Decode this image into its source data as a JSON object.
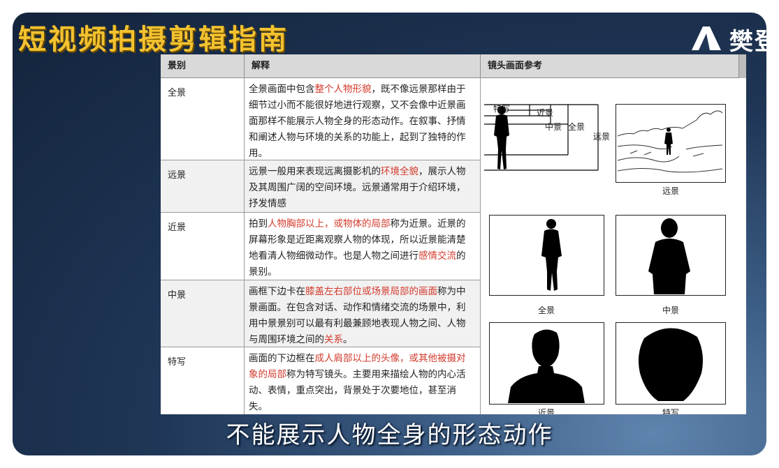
{
  "header": {
    "title": "短视频拍摄剪辑指南",
    "brand": "樊登"
  },
  "table": {
    "columns": [
      "景别",
      "解释",
      "镜头画面参考"
    ],
    "rows": [
      {
        "shot": "全景",
        "desc_parts": [
          {
            "t": "全景画面中包含",
            "hl": false
          },
          {
            "t": "整个人物形貌",
            "hl": true
          },
          {
            "t": "，既不像远景那样由于细节过小而不能很好地进行观察，又不会像中近景画面那样不能展示人物全身的形态动作。在叙事、抒情和阐述人物与环境的关系的功能上，起到了独特的作用。",
            "hl": false
          }
        ]
      },
      {
        "shot": "远景",
        "desc_parts": [
          {
            "t": "远景一般用来表现远离摄影机的",
            "hl": false
          },
          {
            "t": "环境全貌",
            "hl": true
          },
          {
            "t": "，展示人物及其周围广阔的空间环境。远景通常用于介绍环境，抒发情感",
            "hl": false
          }
        ]
      },
      {
        "shot": "近景",
        "desc_parts": [
          {
            "t": "拍到",
            "hl": false
          },
          {
            "t": "人物胸部以上，或物体的局部",
            "hl": true
          },
          {
            "t": "称为近景。近景的屏幕形象是近距离观察人物的体现，所以近景能清楚地看清人物细微动作。也是人物之间进行",
            "hl": false
          },
          {
            "t": "感情交流",
            "hl": true
          },
          {
            "t": "的景别。",
            "hl": false
          }
        ]
      },
      {
        "shot": "中景",
        "desc_parts": [
          {
            "t": "画框下边卡在",
            "hl": false
          },
          {
            "t": "膝盖左右部位或场景局部的画面",
            "hl": true
          },
          {
            "t": "称为中景画面。在包含对话、动作和情绪交流的场景中，利用中景景别可以最有利最兼顾地表现人物之间、人物与周围环境之间的",
            "hl": false
          },
          {
            "t": "关系",
            "hl": true
          },
          {
            "t": "。",
            "hl": false
          }
        ]
      },
      {
        "shot": "特写",
        "desc_parts": [
          {
            "t": "画面的下边框在",
            "hl": false
          },
          {
            "t": "成人肩部以上的头像，或其他被摄对象的局部",
            "hl": true
          },
          {
            "t": "称为特写镜头。主要用来描绘人物的内心活动、表情，重点突出，背景处于次要地位，甚至消失。",
            "hl": false
          }
        ]
      }
    ],
    "diagram_labels": {
      "closeup": "特写",
      "close": "近景",
      "medium": "中景",
      "full": "全景",
      "long": "远景"
    },
    "reference_captions": [
      "远景",
      "全景",
      "中景",
      "近景",
      "特写"
    ]
  },
  "subtitle": "不能展示人物全身的形态动作"
}
